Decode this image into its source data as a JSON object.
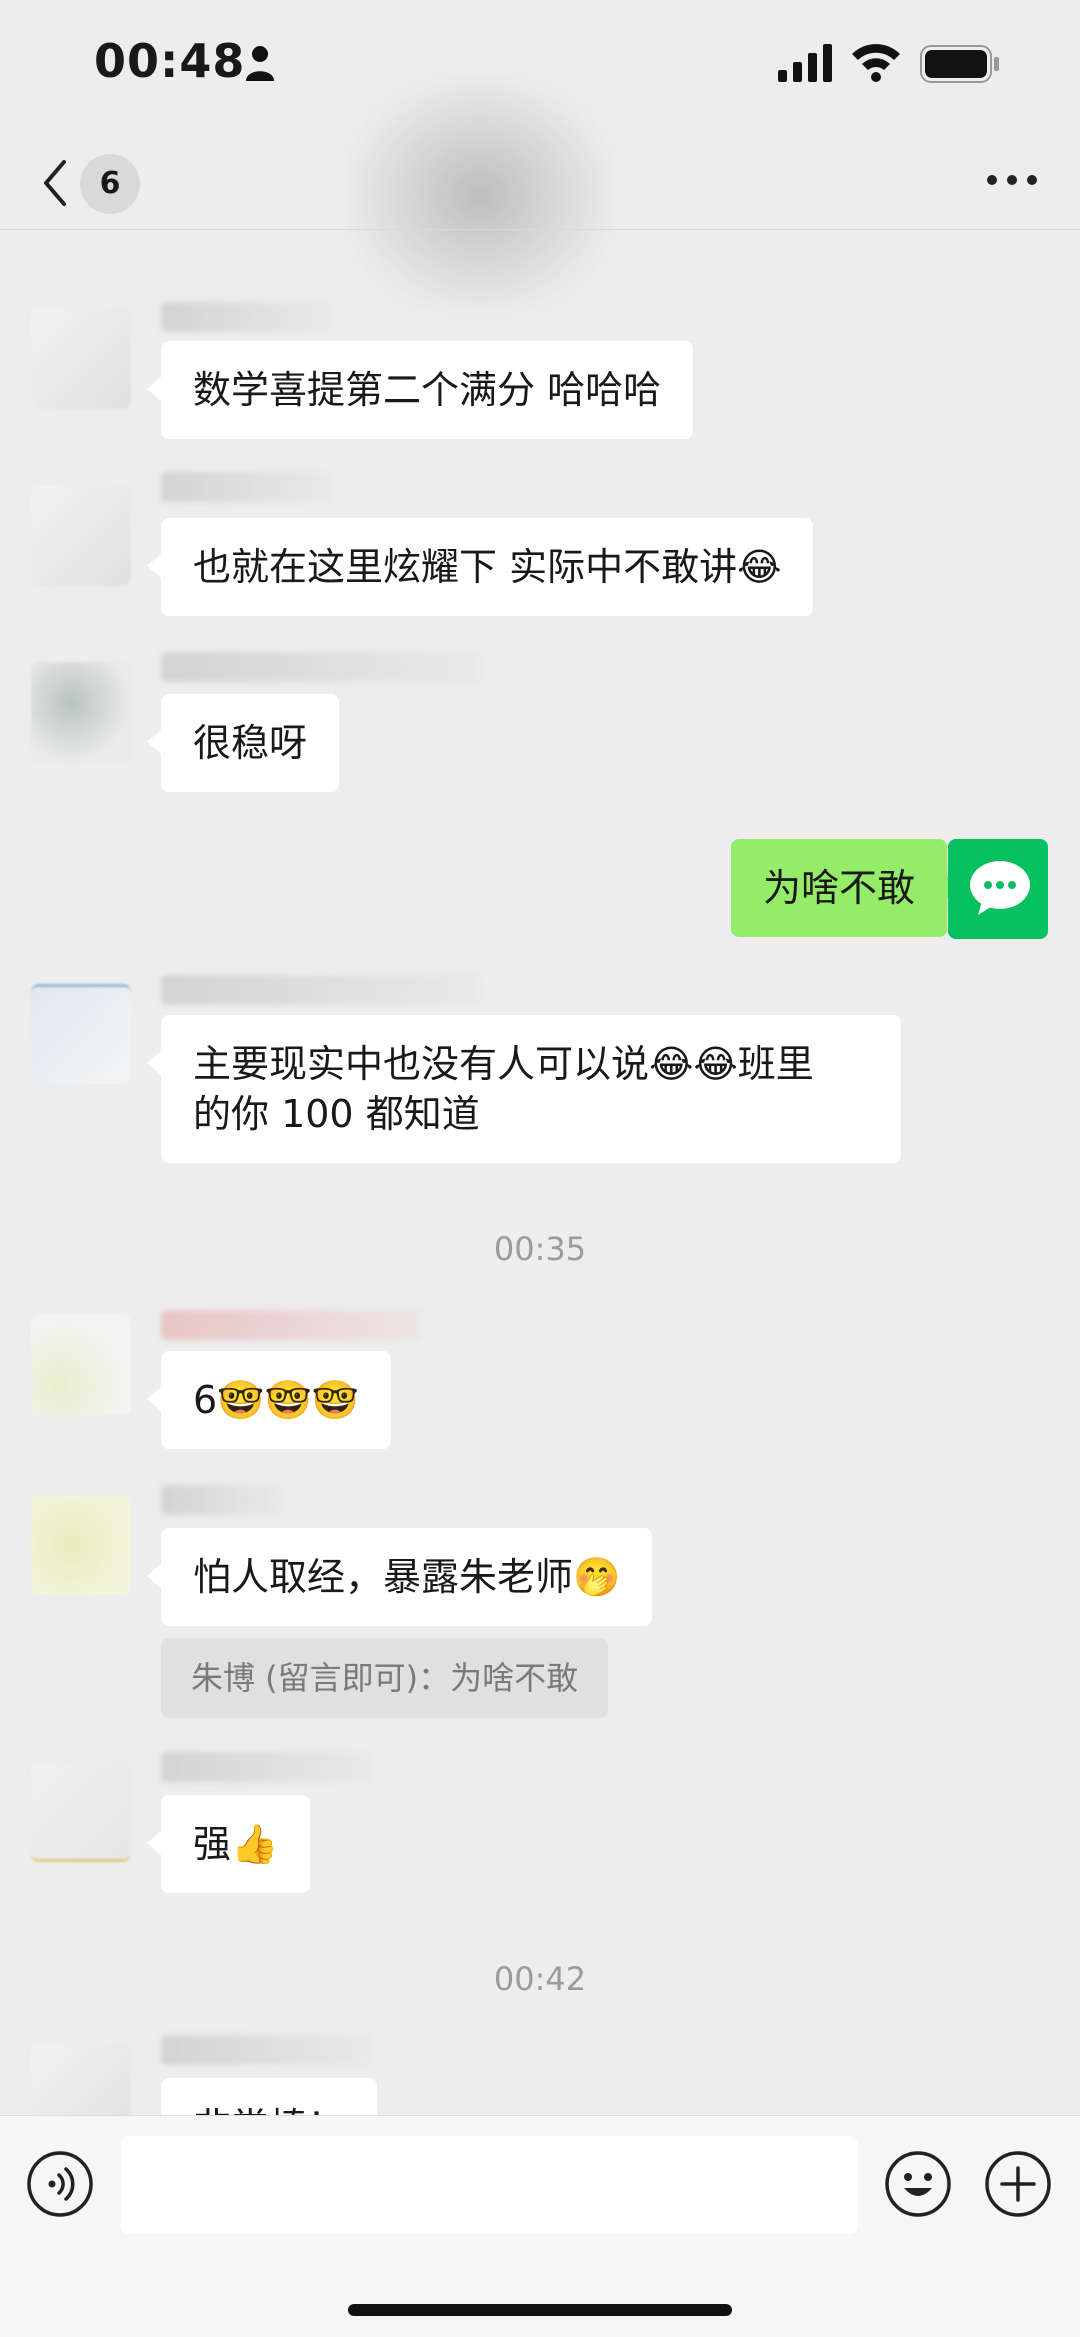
{
  "status_bar": {
    "time": "00:48"
  },
  "nav": {
    "unread_count": "6"
  },
  "messages": [
    {
      "text": "数学喜提第二个满分 哈哈哈"
    },
    {
      "text": "也就在这里炫耀下 实际中不敢讲😂"
    },
    {
      "text": "很稳呀"
    },
    {
      "text": "为啥不敢",
      "mine": true
    },
    {
      "text": "主要现实中也没有人可以说😂😂班里\n的你 100 都知道"
    },
    {
      "text": "6🤓🤓🤓"
    },
    {
      "text": "怕人取经，暴露朱老师🤭"
    },
    {
      "text": "强👍"
    },
    {
      "text": "非常棒！"
    }
  ],
  "quote": {
    "text": "朱博 (留言即可)：为啥不敢"
  },
  "timestamps": [
    "00:35",
    "00:42"
  ],
  "colors": {
    "my_bubble": "#95ec69",
    "my_avatar": "#07c160",
    "background": "#ededed"
  }
}
